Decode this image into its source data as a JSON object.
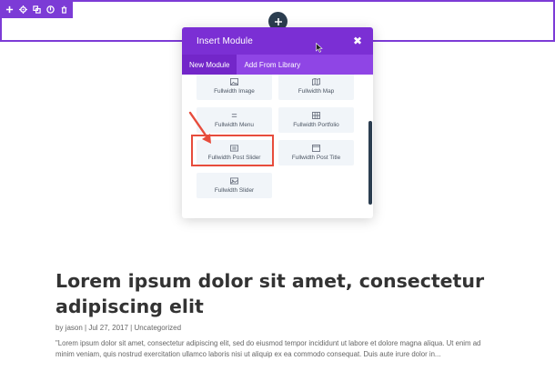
{
  "modal": {
    "title": "Insert Module",
    "close_icon": "close-icon",
    "tabs": [
      {
        "label": "New Module",
        "active": true
      },
      {
        "label": "Add From Library",
        "active": false
      }
    ],
    "modules": [
      {
        "label": "Fullwidth Image",
        "icon": "image-icon"
      },
      {
        "label": "Fullwidth Map",
        "icon": "map-icon"
      },
      {
        "label": "Fullwidth Menu",
        "icon": "menu-icon"
      },
      {
        "label": "Fullwidth Portfolio",
        "icon": "portfolio-grid-icon"
      },
      {
        "label": "Fullwidth Post Slider",
        "icon": "post-slider-icon",
        "highlighted": true
      },
      {
        "label": "Fullwidth Post Title",
        "icon": "post-title-icon"
      },
      {
        "label": "Fullwidth Slider",
        "icon": "slider-icon"
      }
    ]
  },
  "toolbar": {
    "icons": [
      "add-icon",
      "settings-gear-icon",
      "duplicate-icon",
      "save-icon",
      "trash-icon"
    ]
  },
  "post": {
    "title": "Lorem ipsum dolor sit amet, consectetur adipiscing elit",
    "meta": {
      "by": "by ",
      "author": "jason",
      "sep1": " | ",
      "date": "Jul 27, 2017",
      "sep2": " | ",
      "category": "Uncategorized"
    },
    "excerpt": "\"Lorem ipsum dolor sit amet, consectetur adipiscing elit, sed do eiusmod tempor incididunt ut labore et dolore magna aliqua. Ut enim ad minim veniam, quis nostrud exercitation ullamco laboris nisi ut aliquip ex ea commodo consequat. Duis aute irure dolor in..."
  },
  "colors": {
    "accent": "#7c3bd6",
    "header": "#7b2fd4",
    "highlight": "#e74c3c"
  }
}
